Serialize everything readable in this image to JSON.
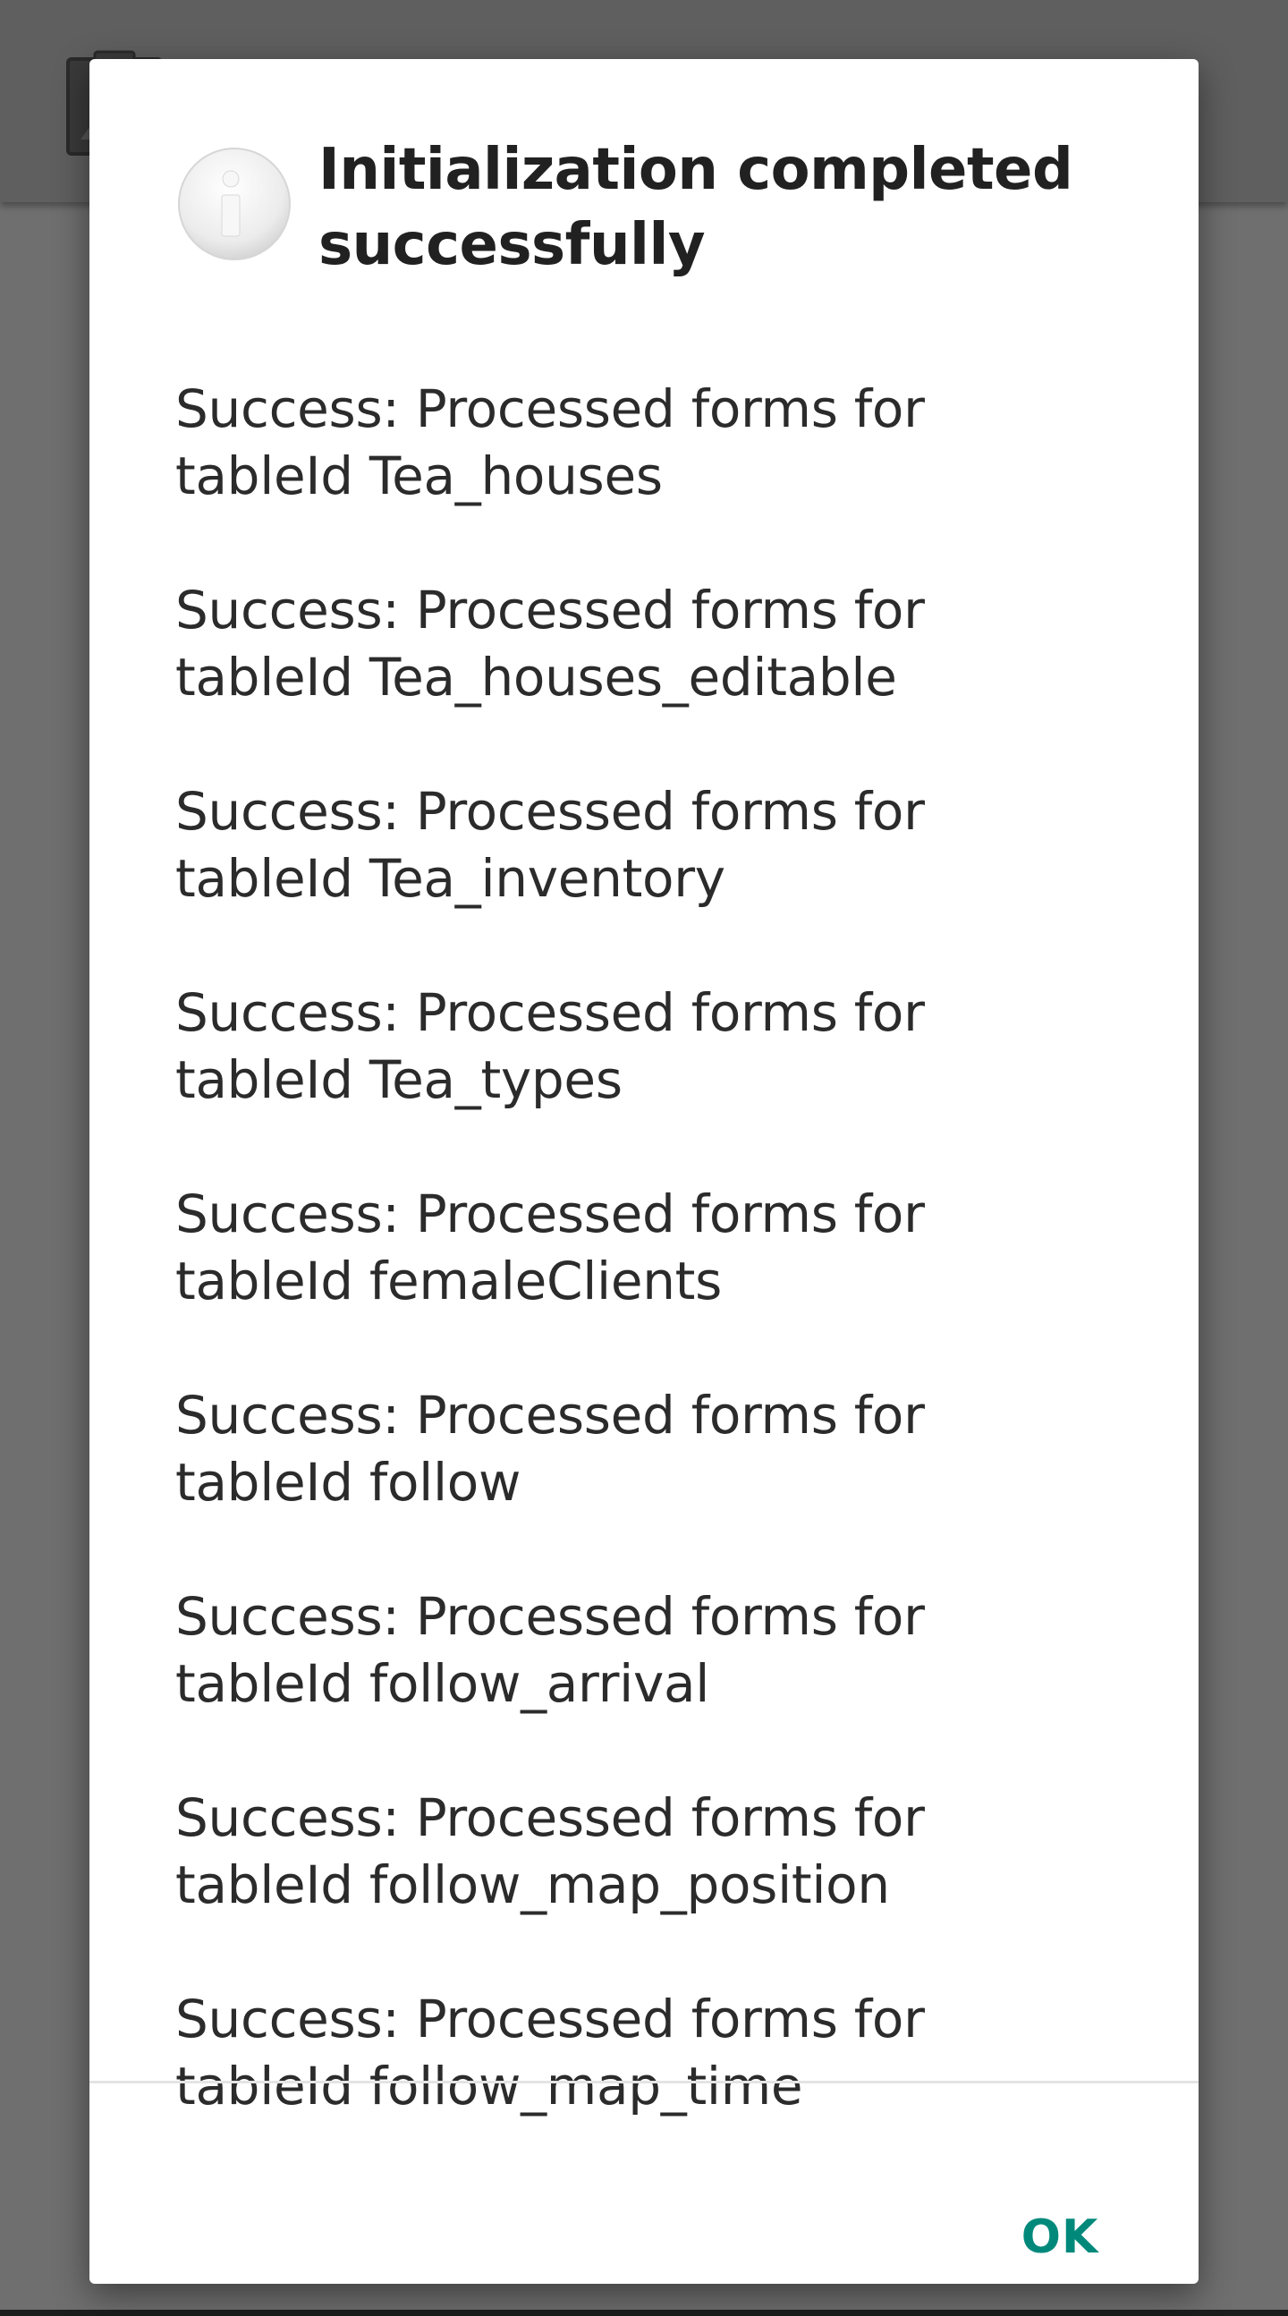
{
  "dialog": {
    "title": "Initialization completed successfully",
    "messages": [
      {
        "line1": "Success: Processed forms for",
        "line2": "tableId Tea_houses"
      },
      {
        "line1": "Success: Processed forms for",
        "line2": "tableId Tea_houses_editable"
      },
      {
        "line1": "Success: Processed forms for",
        "line2": "tableId Tea_inventory"
      },
      {
        "line1": "Success: Processed forms for",
        "line2": "tableId Tea_types"
      },
      {
        "line1": "Success: Processed forms for",
        "line2": "tableId femaleClients"
      },
      {
        "line1": "Success: Processed forms for",
        "line2": "tableId follow"
      },
      {
        "line1": "Success: Processed forms for",
        "line2": "tableId follow_arrival"
      },
      {
        "line1": "Success: Processed forms for",
        "line2": "tableId follow_map_position"
      },
      {
        "line1": "Success: Processed forms for",
        "line2": "tableId follow_map_time"
      }
    ],
    "ok_label": "OK",
    "icon": "info-icon"
  },
  "colors": {
    "accent": "#00897b",
    "scrim": "#6f6f6f",
    "dialog_background": "#ffffff",
    "text_primary": "#212121"
  }
}
